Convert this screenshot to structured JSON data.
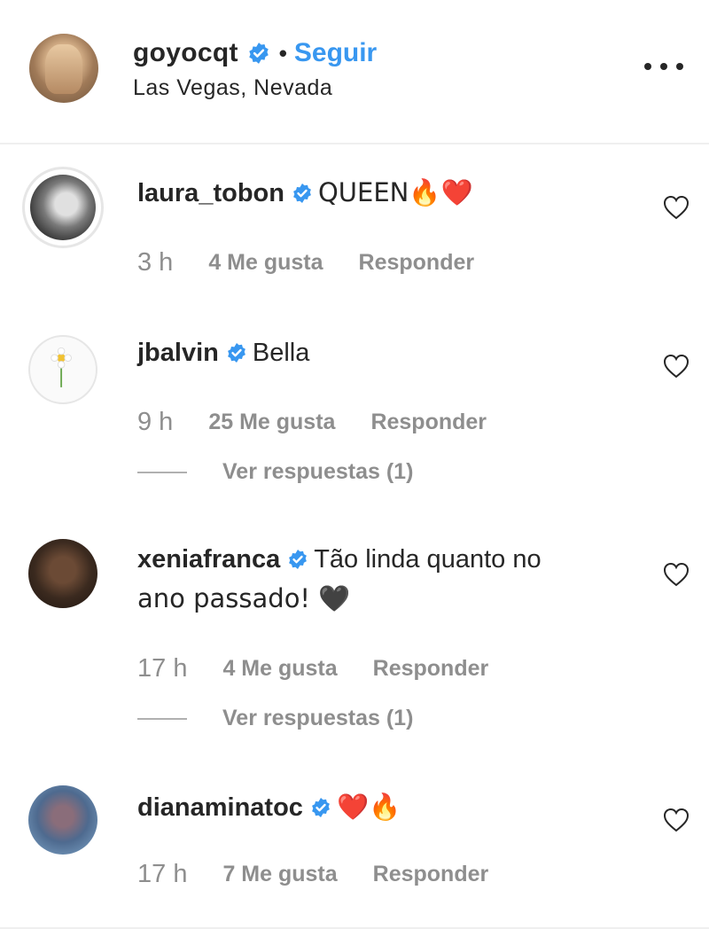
{
  "post_owner": {
    "username": "goyocqt",
    "separator": "•",
    "follow_label": "Seguir",
    "location": "Las Vegas, Nevada"
  },
  "colors": {
    "verified_badge": "#3897f0",
    "follow_link": "#3897f0",
    "muted_text": "#8e8e8e",
    "primary_text": "#262626"
  },
  "comments": [
    {
      "username": "laura_tobon",
      "text": "QUEEN🔥❤️",
      "time": "3 h",
      "likes": "4 Me gusta",
      "reply_label": "Responder"
    },
    {
      "username": "jbalvin",
      "text": "Bella",
      "time": "9 h",
      "likes": "25 Me gusta",
      "reply_label": "Responder",
      "view_replies": "Ver respuestas (1)"
    },
    {
      "username": "xeniafranca",
      "text": "Tão linda quanto no",
      "text_continued": "ano passado! 🖤",
      "time": "17 h",
      "likes": "4 Me gusta",
      "reply_label": "Responder",
      "view_replies": "Ver respuestas (1)"
    },
    {
      "username": "dianaminatoc",
      "text": "❤️🔥",
      "time": "17 h",
      "likes": "7 Me gusta",
      "reply_label": "Responder"
    }
  ]
}
